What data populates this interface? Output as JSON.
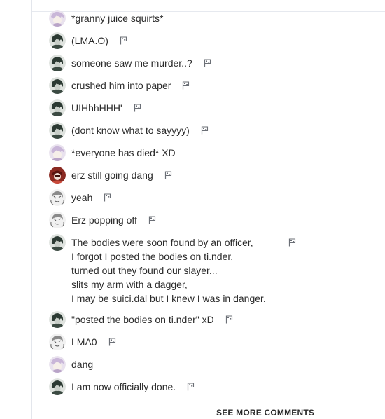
{
  "comments": [
    {
      "avatar": "lilac-hair-avatar",
      "text": "*granny juice squirts*",
      "flag": false
    },
    {
      "avatar": "dark-character-avatar",
      "text": "(LMA.O)",
      "flag": true
    },
    {
      "avatar": "dark-character-avatar",
      "text": "someone saw me murder..?",
      "flag": true
    },
    {
      "avatar": "dark-character-avatar",
      "text": "crushed him into paper",
      "flag": true
    },
    {
      "avatar": "dark-character-avatar",
      "text": "UIHhhHHH'",
      "flag": true
    },
    {
      "avatar": "dark-character-avatar",
      "text": "(dont know what to sayyyy)",
      "flag": true
    },
    {
      "avatar": "lilac-hair-avatar",
      "text": "*everyone has died* XD",
      "flag": false
    },
    {
      "avatar": "red-character-avatar",
      "text": "erz still going dang",
      "flag": true
    },
    {
      "avatar": "sketch-avatar",
      "text": "yeah",
      "flag": true
    },
    {
      "avatar": "sketch-avatar",
      "text": "Erz popping off",
      "flag": true
    },
    {
      "avatar": "dark-character-avatar",
      "text": "The bodies were soon found by an officer,\nI forgot I posted the bodies on ti.nder,\nturned out they found our slayer...\nslits my arm with a dagger,\nI may be suici.dal but I knew I was in danger.",
      "flag": true
    },
    {
      "avatar": "dark-character-avatar",
      "text": "\"posted the bodies on ti.nder\" xD",
      "flag": true
    },
    {
      "avatar": "sketch-avatar",
      "text": "LMA0",
      "flag": true
    },
    {
      "avatar": "lilac-hair-avatar",
      "text": "dang",
      "flag": false
    },
    {
      "avatar": "dark-character-avatar",
      "text": "I am now officially done.",
      "flag": true
    }
  ],
  "see_more_label": "SEE MORE COMMENTS",
  "colors": {
    "text": "#2b2b2b",
    "divider": "#e3e6ec",
    "flag": "#6b6f76"
  }
}
